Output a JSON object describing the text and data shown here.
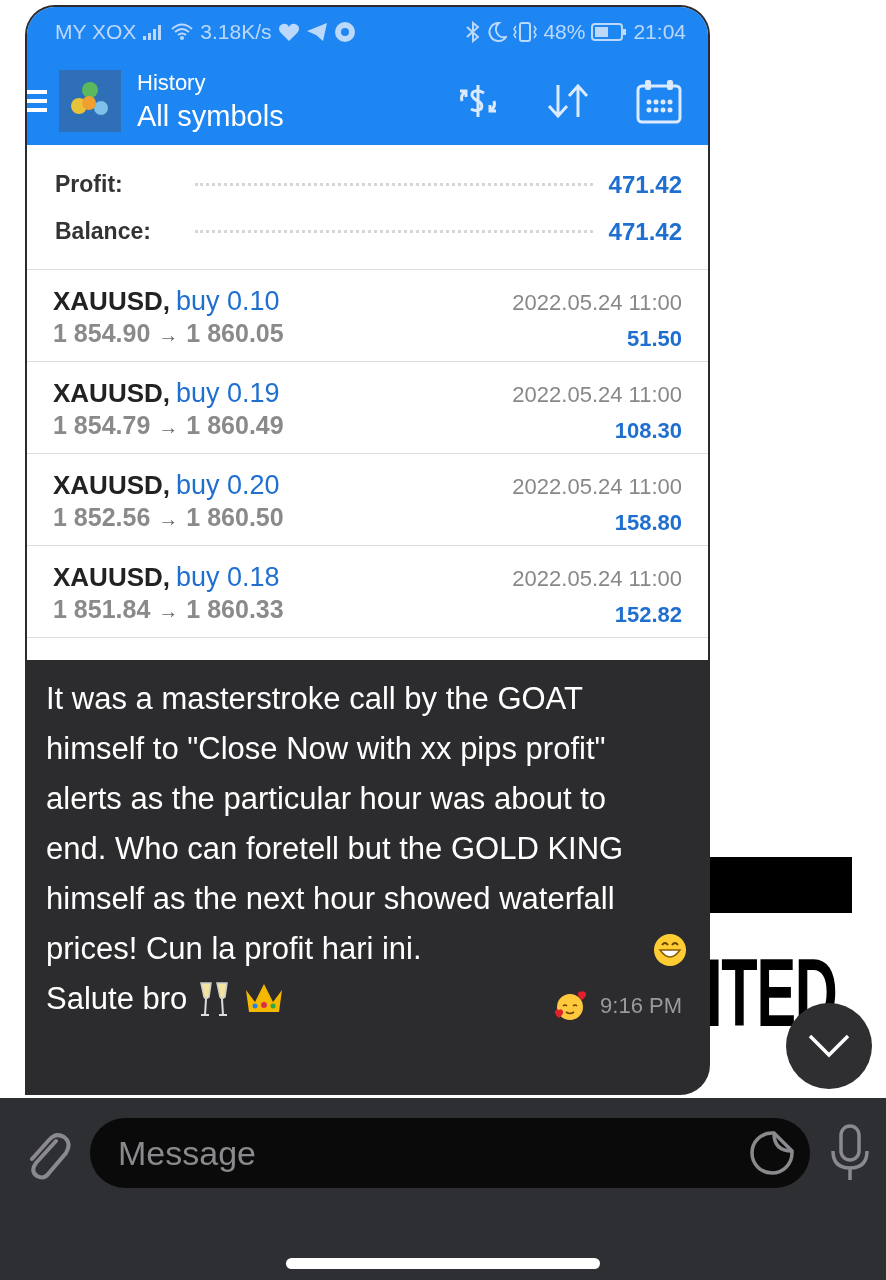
{
  "status_bar": {
    "carrier": "MY XOX",
    "speed": "3.18K/s",
    "battery": "48%",
    "time": "21:04"
  },
  "app_header": {
    "title": "History",
    "subtitle": "All symbols"
  },
  "summary": [
    {
      "label": "Profit:",
      "value": "471.42"
    },
    {
      "label": "Balance:",
      "value": "471.42"
    }
  ],
  "deals": [
    {
      "symbol": "XAUUSD,",
      "order": "buy 0.10",
      "open_price": "1 854.90",
      "arrow": "→",
      "close_price": "1 860.05",
      "time": "2022.05.24 11:00",
      "profit": "51.50"
    },
    {
      "symbol": "XAUUSD,",
      "order": "buy 0.19",
      "open_price": "1 854.79",
      "arrow": "→",
      "close_price": "1 860.49",
      "time": "2022.05.24 11:00",
      "profit": "108.30"
    },
    {
      "symbol": "XAUUSD,",
      "order": "buy 0.20",
      "open_price": "1 852.56",
      "arrow": "→",
      "close_price": "1 860.50",
      "time": "2022.05.24 11:00",
      "profit": "158.80"
    },
    {
      "symbol": "XAUUSD,",
      "order": "buy 0.18",
      "open_price": "1 851.84",
      "arrow": "→",
      "close_price": "1 860.33",
      "time": "2022.05.24 11:00",
      "profit": "152.82"
    }
  ],
  "message": {
    "text": "It was a masterstroke call by the GOAT himself to \"Close Now with xx pips profit\" alerts as the particular hour was about to end. Who can foretell but the GOLD KING himself as the next hour showed waterfall prices! Cun la profit hari ini.",
    "signoff": "Salute bro",
    "time": "9:16 PM"
  },
  "wallpaper_text": "ITED",
  "composer": {
    "placeholder": "Message"
  }
}
